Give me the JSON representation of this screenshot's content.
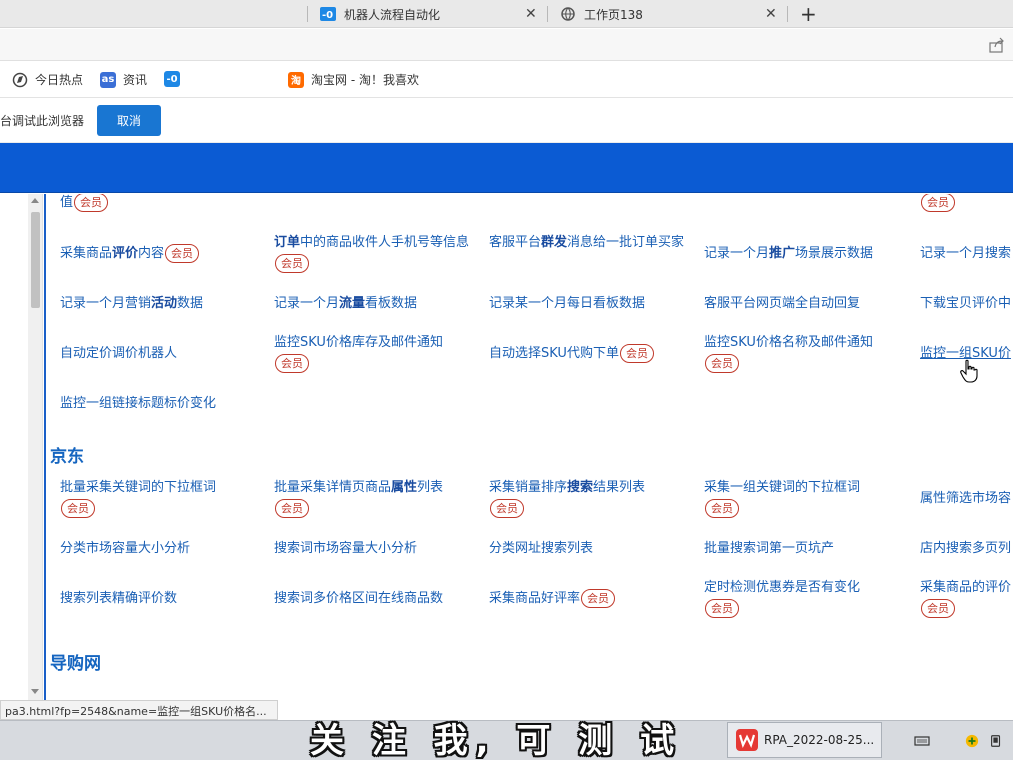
{
  "browser": {
    "tabs": [
      {
        "title": "机器人流程自动化",
        "icon": "rpa-logo-icon"
      },
      {
        "title": "工作页138",
        "icon": "globe-icon"
      }
    ],
    "bookmarks": [
      {
        "label": "今日热点",
        "icon": "hot-news-icon"
      },
      {
        "label": "资讯",
        "icon": "news-icon"
      },
      {
        "label": "",
        "icon": "rpa-logo-icon"
      },
      {
        "label": "淘宝网 - 淘！我喜欢",
        "icon": "taobao-icon"
      }
    ],
    "infobar": {
      "text": "台调试此浏览器",
      "cancel_label": "取消"
    }
  },
  "member_badge": "会员",
  "sections": {
    "top_partial": {
      "badge_left_prefix": "值"
    },
    "rows_a": [
      [
        "采集商品<b>评价</b>内容",
        "<b>订单</b>中的商品收件人手机号等信息",
        "客服平台<b>群发</b>消息给一批订单买家",
        "记录一个月<b>推广</b>场景展示数据",
        "记录一个月搜索"
      ],
      [
        "记录一个月营销<b>活动</b>数据",
        "记录一个月<b>流量</b>看板数据",
        "记录某一个月每日看板数据",
        "客服平台网页端全自动回复",
        "下载宝贝评价中"
      ],
      [
        "自动定价调价机器人",
        "监控SKU价格库存及邮件通知",
        "自动选择SKU代购下单",
        "监控SKU价格名称及邮件通知",
        "监控一组SKU价"
      ],
      [
        "监控一组链接标题标价变化"
      ]
    ],
    "jd_title": "京东",
    "rows_b": [
      [
        "批量采集关键词的下拉框词",
        "批量采集详情页商品<b>属性</b>列表",
        "采集销量排序<b>搜索</b>结果列表",
        "采集一组关键词的下拉框词",
        "属性筛选市场容"
      ],
      [
        "分类市场容量大小分析",
        "搜索词市场容量大小分析",
        "分类网址搜索列表",
        "批量搜索词第一页坑产",
        "店内搜索多页列"
      ],
      [
        "搜索列表精确评价数",
        "搜索词多价格区间在线商品数",
        "采集商品好评率",
        "定时检测优惠券是否有变化",
        "采集商品的评价"
      ]
    ],
    "dgw_title": "导购网"
  },
  "status_url": "pa3.html?fp=2548&name=监控一组SKU价格名...",
  "subtitle": "关 注 我, 可 测 试",
  "taskbar": {
    "item_label": "RPA_2022-08-25..."
  },
  "colors": {
    "accent": "#0b5bd3",
    "link": "#1a5fb4",
    "badge": "#c0392b"
  }
}
